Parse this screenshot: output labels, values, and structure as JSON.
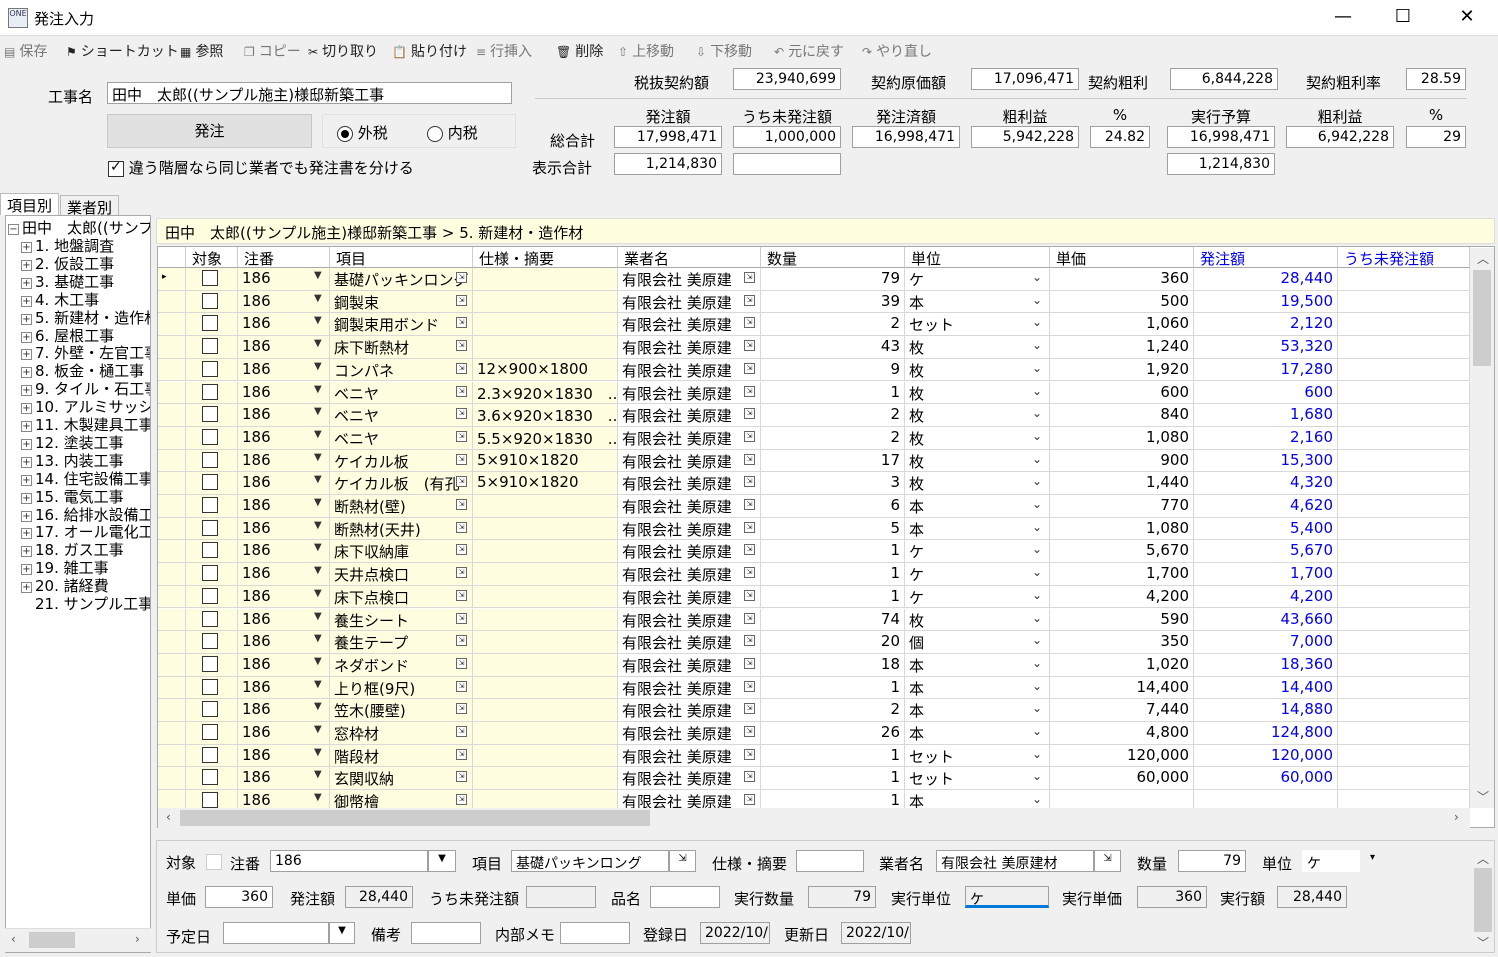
{
  "window": {
    "title": "発注入力",
    "app_icon_text": "ONE"
  },
  "toolbar": [
    {
      "label": "保存",
      "icon": "save-icon",
      "glyph": "▤",
      "enabled": false
    },
    {
      "label": "ショートカット",
      "icon": "shortcut-icon",
      "glyph": "⚑",
      "enabled": true
    },
    {
      "label": "参照",
      "icon": "reference-icon",
      "glyph": "▦",
      "enabled": true
    },
    {
      "label": "コピー",
      "icon": "copy-icon",
      "glyph": "❐",
      "enabled": false
    },
    {
      "label": "切り取り",
      "icon": "cut-icon",
      "glyph": "✂",
      "enabled": true
    },
    {
      "label": "貼り付け",
      "icon": "paste-icon",
      "glyph": "📋",
      "enabled": true
    },
    {
      "label": "行挿入",
      "icon": "insert-row-icon",
      "glyph": "≡",
      "enabled": false
    },
    {
      "label": "削除",
      "icon": "delete-icon",
      "glyph": "🗑",
      "enabled": true
    },
    {
      "label": "上移動",
      "icon": "move-up-icon",
      "glyph": "⇧",
      "enabled": false
    },
    {
      "label": "下移動",
      "icon": "move-down-icon",
      "glyph": "⇩",
      "enabled": false
    },
    {
      "label": "元に戻す",
      "icon": "undo-icon",
      "glyph": "↶",
      "enabled": false
    },
    {
      "label": "やり直し",
      "icon": "redo-icon",
      "glyph": "↷",
      "enabled": false
    }
  ],
  "project": {
    "label": "工事名",
    "value": "田中　太郎((サンプル施主)様邸新築工事"
  },
  "contract": {
    "amount_label": "税抜契約額",
    "amount": "23,940,699",
    "cost_label": "契約原価額",
    "cost": "17,096,471",
    "profit_label": "契約粗利",
    "profit": "6,844,228",
    "rate_label": "契約粗利率",
    "rate": "28.59"
  },
  "order_button": "発注",
  "tax": {
    "exclusive": "外税",
    "inclusive": "内税",
    "selected": "exclusive"
  },
  "separate_checkbox": {
    "label": "違う階層なら同じ業者でも発注書を分ける",
    "checked": true
  },
  "summary": {
    "headers": [
      "発注額",
      "うち未発注額",
      "発注済額",
      "粗利益",
      "%",
      "実行予算",
      "粗利益",
      "%"
    ],
    "total_label": "総合計",
    "total": [
      "17,998,471",
      "1,000,000",
      "16,998,471",
      "5,942,228",
      "24.82",
      "16,998,471",
      "6,942,228",
      "29"
    ],
    "display_label": "表示合計",
    "display_order": "1,214,830",
    "display_unordered": "",
    "display_budget": "1,214,830"
  },
  "tabs": [
    "項目別",
    "業者別"
  ],
  "tree": {
    "root": "田中　太郎((サンプ",
    "items": [
      "1. 地盤調査",
      "2. 仮設工事",
      "3. 基礎工事",
      "4. 木工事",
      "5. 新建材・造作材",
      "6. 屋根工事",
      "7. 外壁・左官工事",
      "8. 板金・樋工事",
      "9. タイル・石工事",
      "10. アルミサッシ工",
      "11. 木製建具工事",
      "12. 塗装工事",
      "13. 内装工事",
      "14. 住宅設備工事",
      "15. 電気工事",
      "16. 給排水設備工",
      "17. オール電化工",
      "18. ガス工事",
      "19. 雑工事",
      "20. 諸経費",
      "21. サンプル工事"
    ]
  },
  "breadcrumb": "田中　太郎((サンプル施主)様邸新築工事 > 5. 新建材・造作材",
  "grid": {
    "headers": [
      "対象",
      "注番",
      "項目",
      "仕様・摘要",
      "業者名",
      "数量",
      "単位",
      "単価",
      "発注額",
      "うち未発注額"
    ],
    "rows": [
      {
        "no": "186",
        "item": "基礎パッキンロング",
        "spec": "",
        "vendor": "有限会社 美原建",
        "qty": "79",
        "unit": "ケ",
        "price": "360",
        "amount": "28,440"
      },
      {
        "no": "186",
        "item": "鋼製束",
        "spec": "",
        "vendor": "有限会社 美原建",
        "qty": "39",
        "unit": "本",
        "price": "500",
        "amount": "19,500"
      },
      {
        "no": "186",
        "item": "鋼製束用ボンド",
        "spec": "",
        "vendor": "有限会社 美原建",
        "qty": "2",
        "unit": "セット",
        "price": "1,060",
        "amount": "2,120"
      },
      {
        "no": "186",
        "item": "床下断熱材",
        "spec": "",
        "vendor": "有限会社 美原建",
        "qty": "43",
        "unit": "枚",
        "price": "1,240",
        "amount": "53,320"
      },
      {
        "no": "186",
        "item": "コンパネ",
        "spec": "12×900×1800",
        "vendor": "有限会社 美原建",
        "qty": "9",
        "unit": "枚",
        "price": "1,920",
        "amount": "17,280"
      },
      {
        "no": "186",
        "item": "ベニヤ",
        "spec": "2.3×920×1830　...",
        "vendor": "有限会社 美原建",
        "qty": "1",
        "unit": "枚",
        "price": "600",
        "amount": "600"
      },
      {
        "no": "186",
        "item": "ベニヤ",
        "spec": "3.6×920×1830　...",
        "vendor": "有限会社 美原建",
        "qty": "2",
        "unit": "枚",
        "price": "840",
        "amount": "1,680"
      },
      {
        "no": "186",
        "item": "ベニヤ",
        "spec": "5.5×920×1830　...",
        "vendor": "有限会社 美原建",
        "qty": "2",
        "unit": "枚",
        "price": "1,080",
        "amount": "2,160"
      },
      {
        "no": "186",
        "item": "ケイカル板",
        "spec": "5×910×1820",
        "vendor": "有限会社 美原建",
        "qty": "17",
        "unit": "枚",
        "price": "900",
        "amount": "15,300"
      },
      {
        "no": "186",
        "item": "ケイカル板　(有孔",
        "spec": "5×910×1820",
        "vendor": "有限会社 美原建",
        "qty": "3",
        "unit": "枚",
        "price": "1,440",
        "amount": "4,320"
      },
      {
        "no": "186",
        "item": "断熱材(壁)",
        "spec": "",
        "vendor": "有限会社 美原建",
        "qty": "6",
        "unit": "本",
        "price": "770",
        "amount": "4,620"
      },
      {
        "no": "186",
        "item": "断熱材(天井)",
        "spec": "",
        "vendor": "有限会社 美原建",
        "qty": "5",
        "unit": "本",
        "price": "1,080",
        "amount": "5,400"
      },
      {
        "no": "186",
        "item": "床下収納庫",
        "spec": "",
        "vendor": "有限会社 美原建",
        "qty": "1",
        "unit": "ケ",
        "price": "5,670",
        "amount": "5,670"
      },
      {
        "no": "186",
        "item": "天井点検口",
        "spec": "",
        "vendor": "有限会社 美原建",
        "qty": "1",
        "unit": "ケ",
        "price": "1,700",
        "amount": "1,700"
      },
      {
        "no": "186",
        "item": "床下点検口",
        "spec": "",
        "vendor": "有限会社 美原建",
        "qty": "1",
        "unit": "ケ",
        "price": "4,200",
        "amount": "4,200"
      },
      {
        "no": "186",
        "item": "養生シート",
        "spec": "",
        "vendor": "有限会社 美原建",
        "qty": "74",
        "unit": "枚",
        "price": "590",
        "amount": "43,660"
      },
      {
        "no": "186",
        "item": "養生テープ",
        "spec": "",
        "vendor": "有限会社 美原建",
        "qty": "20",
        "unit": "個",
        "price": "350",
        "amount": "7,000"
      },
      {
        "no": "186",
        "item": "ネダボンド",
        "spec": "",
        "vendor": "有限会社 美原建",
        "qty": "18",
        "unit": "本",
        "price": "1,020",
        "amount": "18,360"
      },
      {
        "no": "186",
        "item": "上り框(9尺)",
        "spec": "",
        "vendor": "有限会社 美原建",
        "qty": "1",
        "unit": "本",
        "price": "14,400",
        "amount": "14,400"
      },
      {
        "no": "186",
        "item": "笠木(腰壁)",
        "spec": "",
        "vendor": "有限会社 美原建",
        "qty": "2",
        "unit": "本",
        "price": "7,440",
        "amount": "14,880"
      },
      {
        "no": "186",
        "item": "窓枠材",
        "spec": "",
        "vendor": "有限会社 美原建",
        "qty": "26",
        "unit": "本",
        "price": "4,800",
        "amount": "124,800"
      },
      {
        "no": "186",
        "item": "階段材",
        "spec": "",
        "vendor": "有限会社 美原建",
        "qty": "1",
        "unit": "セット",
        "price": "120,000",
        "amount": "120,000"
      },
      {
        "no": "186",
        "item": "玄関収納",
        "spec": "",
        "vendor": "有限会社 美原建",
        "qty": "1",
        "unit": "セット",
        "price": "60,000",
        "amount": "60,000"
      },
      {
        "no": "186",
        "item": "御幣檜",
        "spec": "",
        "vendor": "有限会社 美原建",
        "qty": "1",
        "unit": "本",
        "price": "",
        "amount": ""
      }
    ]
  },
  "detail": {
    "target_label": "対象",
    "no_label": "注番",
    "no": "186",
    "item_label": "項目",
    "item": "基礎パッキンロング",
    "spec_label": "仕様・摘要",
    "spec": "",
    "vendor_label": "業者名",
    "vendor": "有限会社 美原建材",
    "qty_label": "数量",
    "qty": "79",
    "unit_label": "単位",
    "unit": "ケ",
    "price_label": "単価",
    "price": "360",
    "amount_label": "発注額",
    "amount": "28,440",
    "unordered_label": "うち未発注額",
    "unordered": "",
    "product_label": "品名",
    "product": "",
    "exec_qty_label": "実行数量",
    "exec_qty": "79",
    "exec_unit_label": "実行単位",
    "exec_unit": "ケ",
    "exec_price_label": "実行単価",
    "exec_price": "360",
    "exec_amount_label": "実行額",
    "exec_amount": "28,440",
    "date_label": "予定日",
    "date": "",
    "note_label": "備考",
    "note": "",
    "memo_label": "内部メモ",
    "memo": "",
    "reg_label": "登録日",
    "reg": "2022/10/",
    "upd_label": "更新日",
    "upd": "2022/10/"
  },
  "colors": {
    "accent_blue": "#0000ee",
    "highlight_yellow": "#fffde0",
    "breadcrumb_bg": "#ffffe0"
  }
}
